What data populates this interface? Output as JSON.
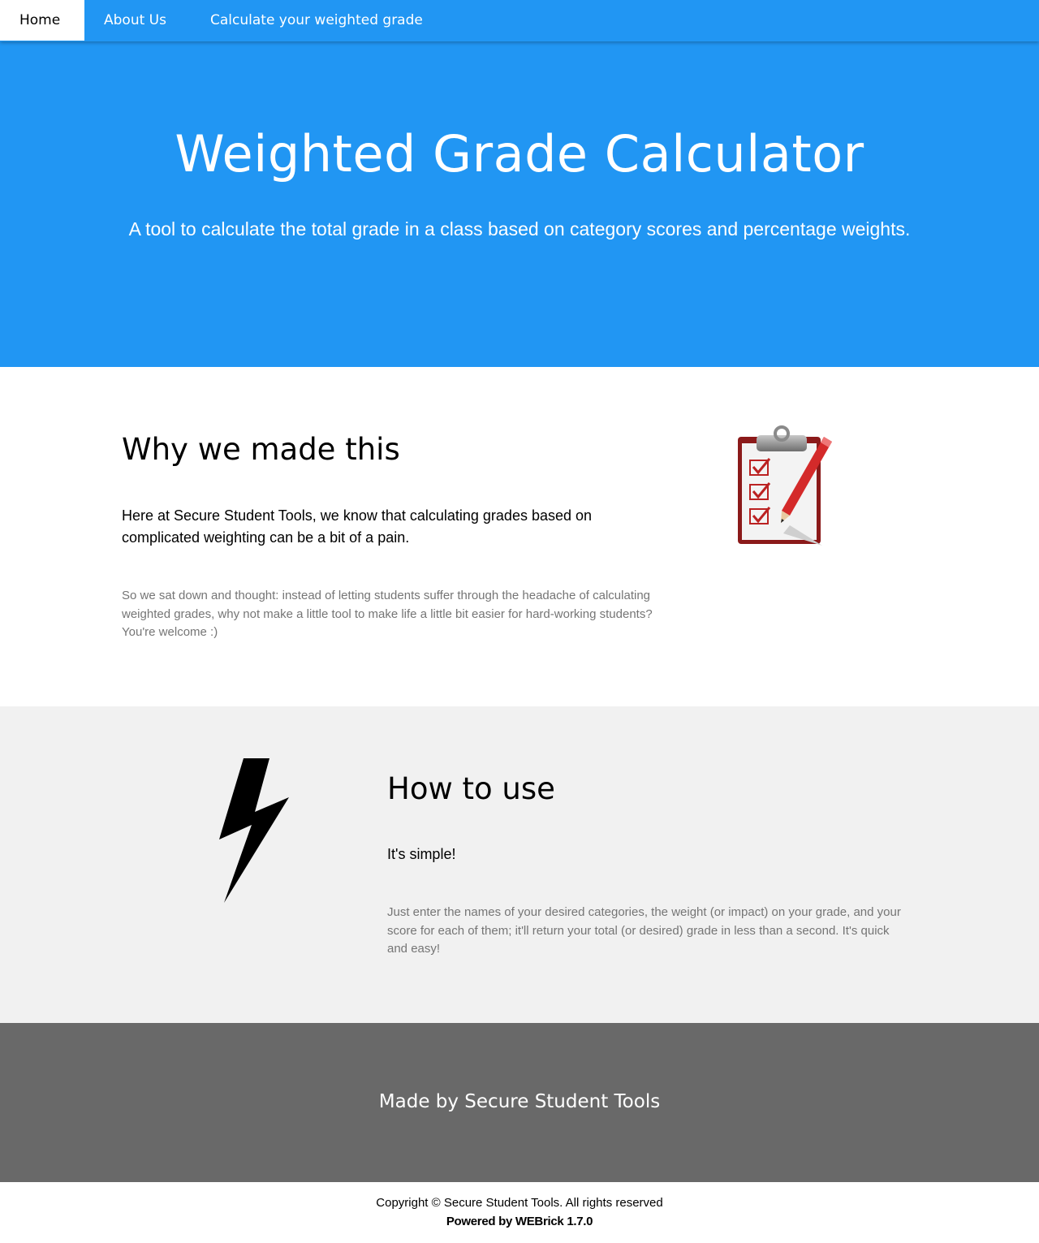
{
  "nav": {
    "home": "Home",
    "about": "About Us",
    "calculate": "Calculate your weighted grade"
  },
  "hero": {
    "title": "Weighted Grade Calculator",
    "subtitle": "A tool to calculate the total grade in a class based on category scores and percentage weights."
  },
  "why": {
    "heading": "Why we made this",
    "lead": "Here at Secure Student Tools, we know that calculating grades based on complicated weighting can be a bit of a pain.",
    "body": "So we sat down and thought: instead of letting students suffer through the headache of calculating weighted grades, why not make a little tool to make life a little bit easier for hard-working students? You're welcome :)",
    "icon": "clipboard-checklist-icon"
  },
  "how": {
    "heading": "How to use",
    "lead": "It's simple!",
    "body": "Just enter the names of your desired categories, the weight (or impact) on your grade, and your score for each of them; it'll return your total (or desired) grade in less than a second. It's quick and easy!",
    "icon": "lightning-bolt-icon"
  },
  "footer": {
    "made_by": "Made by Secure Student Tools",
    "copyright": "Copyright © Secure Student Tools. All rights reserved",
    "powered_by": "Powered by WEBrick 1.7.0"
  },
  "colors": {
    "primary": "#2196f3",
    "light_gray": "#f1f1f1",
    "dark_gray": "#696969",
    "muted_text": "#757575"
  }
}
